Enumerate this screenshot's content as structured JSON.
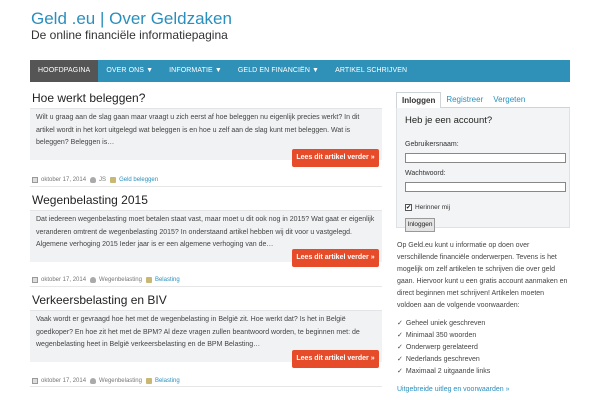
{
  "header": {
    "site_title": "Geld .eu | Over Geldzaken",
    "tagline": "De online financiële informatiepagina"
  },
  "nav": {
    "items": [
      {
        "label": "HOOFDPAGINA"
      },
      {
        "label": "OVER ONS ▼"
      },
      {
        "label": "INFORMATIE ▼"
      },
      {
        "label": "GELD EN FINANCIËN ▼"
      },
      {
        "label": "ARTIKEL SCHRIJVEN"
      }
    ]
  },
  "posts": [
    {
      "title": "Hoe werkt beleggen?",
      "excerpt": "Wilt u graag aan de slag gaan maar vraagt u zich eerst af hoe beleggen nu eigenlijk precies werkt? In dit artikel wordt in het kort uitgelegd wat beleggen is en hoe u zelf aan de slag kunt met beleggen. Wat is beleggen? Beleggen is…",
      "read_more": "Lees dit artikel verder »",
      "date": "oktober 17, 2014",
      "author": "JS",
      "category": "Geld beleggen"
    },
    {
      "title": "Wegenbelasting 2015",
      "excerpt": "Dat iedereen wegenbelasting moet betalen staat vast, maar moet u dit ook nog in 2015? Wat gaat er eigenlijk veranderen omtrent de wegenbelasting 2015? In onderstaand artikel hebben wij dit voor u vastgelegd. Algemene verhoging 2015 Ieder jaar is er een algemene verhoging van de…",
      "read_more": "Lees dit artikel verder »",
      "date": "oktober 17, 2014",
      "author": "Wegenbelasting",
      "category": "Belasting"
    },
    {
      "title": "Verkeersbelasting en BIV",
      "excerpt": "Vaak wordt er gevraagd hoe het met de wegenbelasting in België zit. Hoe werkt dat? Is het in België goedkoper? En hoe zit het met de BPM? Al deze vragen zullen beantwoord worden, te beginnen met: de wegenbelasting heet in België verkeersbelasting  en de BPM Belasting…",
      "read_more": "Lees dit artikel verder »",
      "date": "oktober 17, 2014",
      "author": "Wegenbelasting",
      "category": "Belasting"
    }
  ],
  "sidebar": {
    "tabs": [
      {
        "label": "Inloggen"
      },
      {
        "label": "Registreer"
      },
      {
        "label": "Vergeten"
      }
    ],
    "login": {
      "heading": "Heb je een account?",
      "username_label": "Gebruikersnaam:",
      "username_value": "",
      "password_label": "Wachtwoord:",
      "password_value": "",
      "remember_label": "Herinner mij",
      "remember_checked": "✔",
      "button_label": "Inloggen"
    },
    "info_text": "Op Geld.eu kunt u informatie op doen over verschillende financiële onderwerpen. Tevens is het mogelijk om zelf artikelen te schrijven die over geld gaan. Hiervoor kunt u een gratis account aanmaken en direct beginnen met schrijven! Artikelen moeten voldoen aan de volgende voorwaarden:",
    "requirements": [
      "Geheel uniek geschreven",
      "Minimaal 350 woorden",
      "Onderwerp gerelateerd",
      "Nederlands geschreven",
      "Maximaal 2 uitgaande links"
    ],
    "check_glyph": "✓",
    "guide_link": "Uitgebreide uitleg en voorwaarden »"
  },
  "colors": {
    "accent": "#2a8fbd",
    "navbar": "#2f91b8",
    "nav_active": "#555555",
    "read_more": "#e74c2a"
  }
}
